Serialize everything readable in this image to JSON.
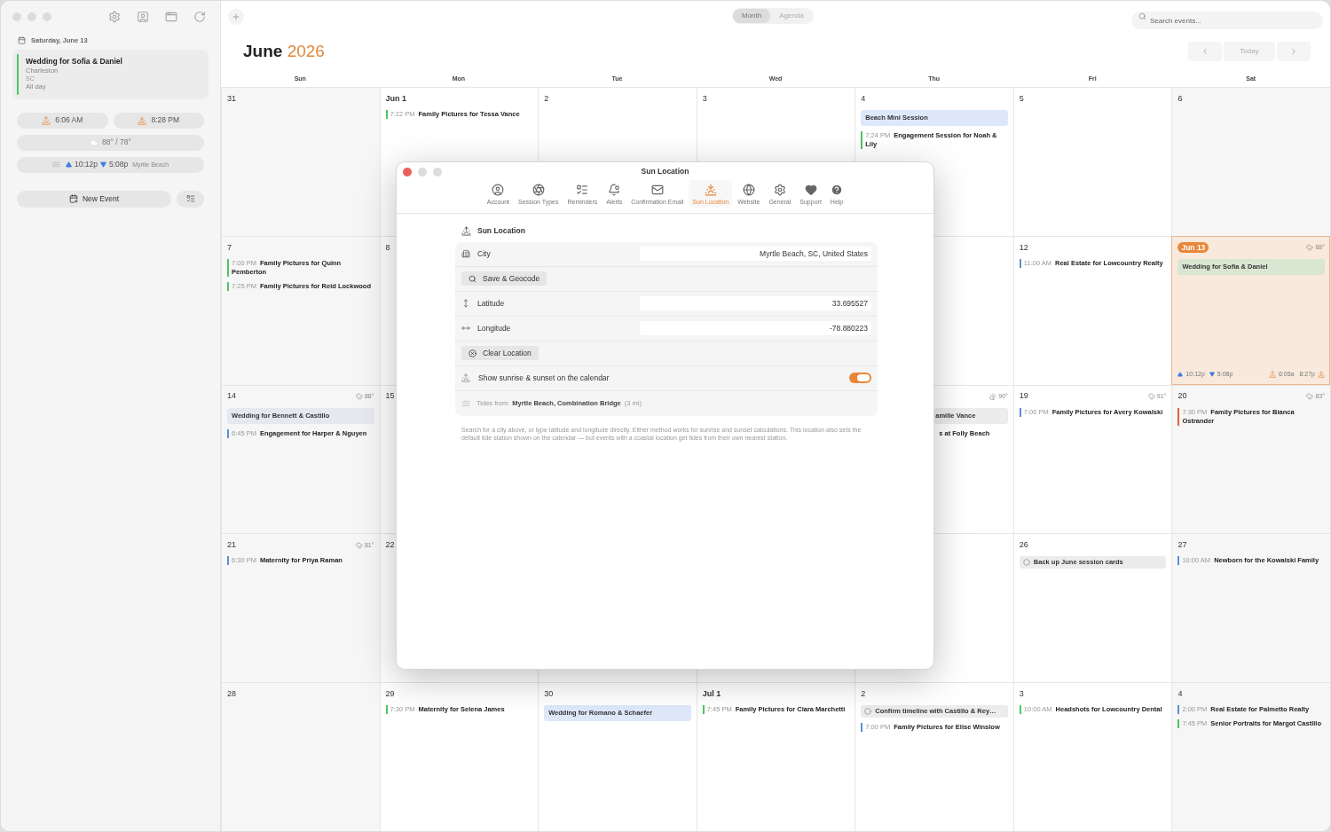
{
  "sidebar": {
    "date": "Saturday, June 13",
    "event": {
      "title": "Wedding for Sofia & Daniel",
      "city": "Charleston",
      "state": "SC",
      "when": "All day",
      "color": "#4cc764"
    },
    "sunrise": "6:06 AM",
    "sunset": "8:28 PM",
    "weather": "88° / 78°",
    "tides": {
      "high": "10:12p",
      "low": "5:08p",
      "station": "Myrtle Beach"
    },
    "new_event": "New Event"
  },
  "toolbar": {
    "views": [
      {
        "label": "Month",
        "selected": true
      },
      {
        "label": "Agenda",
        "selected": false
      }
    ],
    "search": {
      "placeholder": "Search events..."
    }
  },
  "header": {
    "month": "June",
    "year": "2026",
    "today": "Today"
  },
  "weekdays": [
    "Sun",
    "Mon",
    "Tue",
    "Wed",
    "Thu",
    "Fri",
    "Sat"
  ],
  "weeks": [
    {
      "sun": {
        "label": "31",
        "today": false
      },
      "mon": {
        "label": "Jun 1",
        "today": false,
        "events": [
          {
            "kind": "timed",
            "time": "7:22 PM",
            "title": "Family Pictures for Tessa Vance",
            "color": "#4cc764"
          }
        ]
      },
      "tue": {
        "label": "2",
        "today": false
      },
      "wed": {
        "label": "3",
        "today": false
      },
      "thu": {
        "label": "4",
        "today": false,
        "events": [
          {
            "kind": "allday",
            "title": "Beach Mini Session",
            "color": "#dfe8fa"
          },
          {
            "kind": "timed",
            "time": "7:24 PM",
            "title": "Engagement Session for Noah & Lily",
            "color": "#4cc764"
          }
        ]
      },
      "fri": {
        "label": "5",
        "today": false
      },
      "sat": {
        "label": "6",
        "today": false
      }
    },
    {
      "sun": {
        "label": "7",
        "today": false,
        "events": [
          {
            "kind": "timed",
            "time": "7:00 PM",
            "title": "Family Pictures for Quinn Pemberton",
            "color": "#4cc764"
          },
          {
            "kind": "timed",
            "time": "7:25 PM",
            "title": "Family Pictures for Reid Lockwood",
            "color": "#4cc764"
          }
        ]
      },
      "mon": {
        "label": "8",
        "today": false
      },
      "fri": {
        "label": "12",
        "today": false,
        "events": [
          {
            "kind": "timed",
            "time": "11:00 AM",
            "title": "Real Estate for Lowcountry Realty",
            "color": "#5b8fd9"
          }
        ]
      },
      "sat": {
        "label": "Jun 13",
        "today": true,
        "weather": {
          "text": "88°",
          "kind": "rain"
        },
        "events": [
          {
            "kind": "allday",
            "title": "Wedding for Sofia & Daniel",
            "color": "#d9e7d2"
          }
        ],
        "footer": {
          "high": "10:12p",
          "low": "5:08p",
          "sunrise": "6:05a",
          "sunset": "8:27p"
        }
      }
    },
    {
      "sun": {
        "label": "14",
        "today": false,
        "weather": {
          "text": "88°",
          "kind": "rain"
        },
        "events": [
          {
            "kind": "allday",
            "title": "Wedding for Bennett & Castillo",
            "color": "#e5e8ee"
          },
          {
            "kind": "timed",
            "time": "6:45 PM",
            "title": "Engagement for Harper & Nguyen",
            "color": "#5b8fd9"
          }
        ]
      },
      "mon": {
        "label": "15",
        "today": false
      },
      "thu": {
        "today": false,
        "clipped": true,
        "weather": {
          "text": "90°",
          "kind": "partly-cloudy"
        },
        "events": [
          {
            "kind": "allday",
            "title": "amille Vance",
            "color": "#ececec"
          },
          {
            "kind": "timed",
            "title": "s at Folly Beach",
            "color": "#ffffff"
          }
        ]
      },
      "fri": {
        "label": "19",
        "today": false,
        "weather": {
          "text": "91°",
          "kind": "rain"
        },
        "events": [
          {
            "kind": "timed",
            "time": "7:00 PM",
            "title": "Family Pictures for Avery Kowalski",
            "color": "#5b8fd9"
          }
        ]
      },
      "sat": {
        "label": "20",
        "today": false,
        "weather": {
          "text": "83°",
          "kind": "rain"
        },
        "events": [
          {
            "kind": "timed",
            "time": "7:30 PM",
            "title": "Family Pictures for Bianca Ostrander",
            "color": "#e0623a"
          }
        ]
      }
    },
    {
      "sun": {
        "label": "21",
        "today": false,
        "weather": {
          "text": "81°",
          "kind": "rain"
        },
        "events": [
          {
            "kind": "timed",
            "time": "6:30 PM",
            "title": "Maternity for Priya Raman",
            "color": "#5b8fd9"
          }
        ]
      },
      "mon": {
        "label": "22",
        "today": false
      },
      "thu": {
        "today": false
      },
      "fri": {
        "label": "26",
        "today": false,
        "events": [
          {
            "kind": "task",
            "title": "Back up June session cards",
            "color": "#ececec"
          }
        ]
      },
      "sat": {
        "label": "27",
        "today": false,
        "events": [
          {
            "kind": "timed",
            "time": "10:00 AM",
            "title": "Newborn for the Kowalski Family",
            "color": "#5b8fd9"
          }
        ]
      }
    },
    {
      "sun": {
        "label": "28",
        "today": false
      },
      "mon": {
        "label": "29",
        "today": false,
        "events": [
          {
            "kind": "timed",
            "time": "7:30 PM",
            "title": "Maternity for Selena James",
            "color": "#4cc764"
          }
        ]
      },
      "tue": {
        "label": "30",
        "today": false,
        "events": [
          {
            "kind": "allday",
            "title": "Wedding for Romano & Schaefer",
            "color": "#dfe8fa"
          }
        ]
      },
      "wed": {
        "label": "Jul 1",
        "today": false,
        "events": [
          {
            "kind": "timed",
            "time": "7:45 PM",
            "title": "Family Pictures for Clara Marchetti",
            "color": "#4cc764"
          }
        ]
      },
      "thu": {
        "label": "2",
        "today": false,
        "events": [
          {
            "kind": "task",
            "title": "Confirm timeline with Castillo & Rey…",
            "color": "#ececec"
          },
          {
            "kind": "timed",
            "time": "7:00 PM",
            "title": "Family Pictures for Elise Winslow",
            "color": "#5b8fd9"
          }
        ]
      },
      "fri": {
        "label": "3",
        "today": false,
        "events": [
          {
            "kind": "timed",
            "time": "10:00 AM",
            "title": "Headshots for Lowcountry Dental",
            "color": "#4cc764"
          }
        ]
      },
      "sat": {
        "label": "4",
        "today": false,
        "events": [
          {
            "kind": "timed",
            "time": "2:00 PM",
            "title": "Real Estate for Palmetto Realty",
            "color": "#5b8fd9"
          },
          {
            "kind": "timed",
            "time": "7:45 PM",
            "title": "Senior Portraits for Margot Castillo",
            "color": "#4cc764"
          }
        ]
      }
    }
  ],
  "dialog": {
    "title": "Sun Location",
    "tabs": [
      {
        "label": "Account",
        "selected": false
      },
      {
        "label": "Session Types",
        "selected": false
      },
      {
        "label": "Reminders",
        "selected": false
      },
      {
        "label": "Alerts",
        "selected": false
      },
      {
        "label": "Confirmation Email",
        "selected": false
      },
      {
        "label": "Sun Location",
        "selected": true
      },
      {
        "label": "Website",
        "selected": false
      },
      {
        "label": "General",
        "selected": false
      },
      {
        "label": "Support",
        "selected": false
      },
      {
        "label": "Help",
        "selected": false
      }
    ],
    "section": "Sun Location",
    "city": {
      "label": "City",
      "value": "Myrtle Beach, SC, United States"
    },
    "geocode": "Save & Geocode",
    "latitude": {
      "label": "Latitude",
      "value": "33.695527"
    },
    "longitude": {
      "label": "Longitude",
      "value": "-78.880223"
    },
    "clear": "Clear Location",
    "toggle": {
      "label": "Show sunrise & sunset on the calendar",
      "on": true
    },
    "tides": {
      "label": "Tides from:",
      "station": "Myrtle Beach, Combination Bridge",
      "distance": "(3 mi)"
    },
    "note": "Search for a city above, or type latitude and longitude directly. Either method works for sunrise and sunset calculations. This location also sets the default tide station shown on the calendar — but events with a coastal location get tides from their own nearest station."
  }
}
